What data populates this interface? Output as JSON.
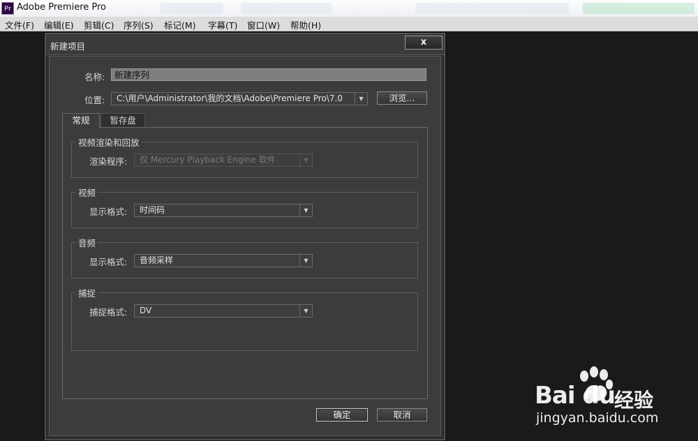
{
  "window": {
    "title": "Adobe Premiere Pro",
    "logo_text": "Pr"
  },
  "menu": [
    {
      "label": "文件(F)"
    },
    {
      "label": "编辑(E)"
    },
    {
      "label": "剪辑(C)"
    },
    {
      "label": "序列(S)"
    },
    {
      "label": "标记(M)"
    },
    {
      "label": "字幕(T)"
    },
    {
      "label": "窗口(W)"
    },
    {
      "label": "帮助(H)"
    }
  ],
  "dialog": {
    "title": "新建项目",
    "close_label": "x",
    "name_label": "名称:",
    "name_value": "新建序列",
    "location_label": "位置:",
    "location_value": "C:\\用户\\Administrator\\我的文档\\Adobe\\Premiere Pro\\7.0",
    "browse_label": "浏览...",
    "tabs": [
      {
        "label": "常规",
        "active": true
      },
      {
        "label": "暂存盘",
        "active": false
      }
    ],
    "groups": {
      "render": {
        "title": "视频渲染和回放",
        "field_label": "渲染程序:",
        "field_value": "仅 Mercury Playback Engine 软件",
        "disabled": true
      },
      "video": {
        "title": "视频",
        "field_label": "显示格式:",
        "field_value": "时间码"
      },
      "audio": {
        "title": "音频",
        "field_label": "显示格式:",
        "field_value": "音频采样"
      },
      "capture": {
        "title": "捕捉",
        "field_label": "捕捉格式:",
        "field_value": "DV"
      }
    },
    "ok_label": "确定",
    "cancel_label": "取消"
  },
  "watermark": {
    "brand": "Bai du",
    "brand_cn": "经验",
    "url": "jingyan.baidu.com"
  },
  "colors": {
    "dialog_bg": "#3c3c3c",
    "workspace_bg": "#1a1a1a",
    "name_field_bg": "#7d7d7d"
  }
}
